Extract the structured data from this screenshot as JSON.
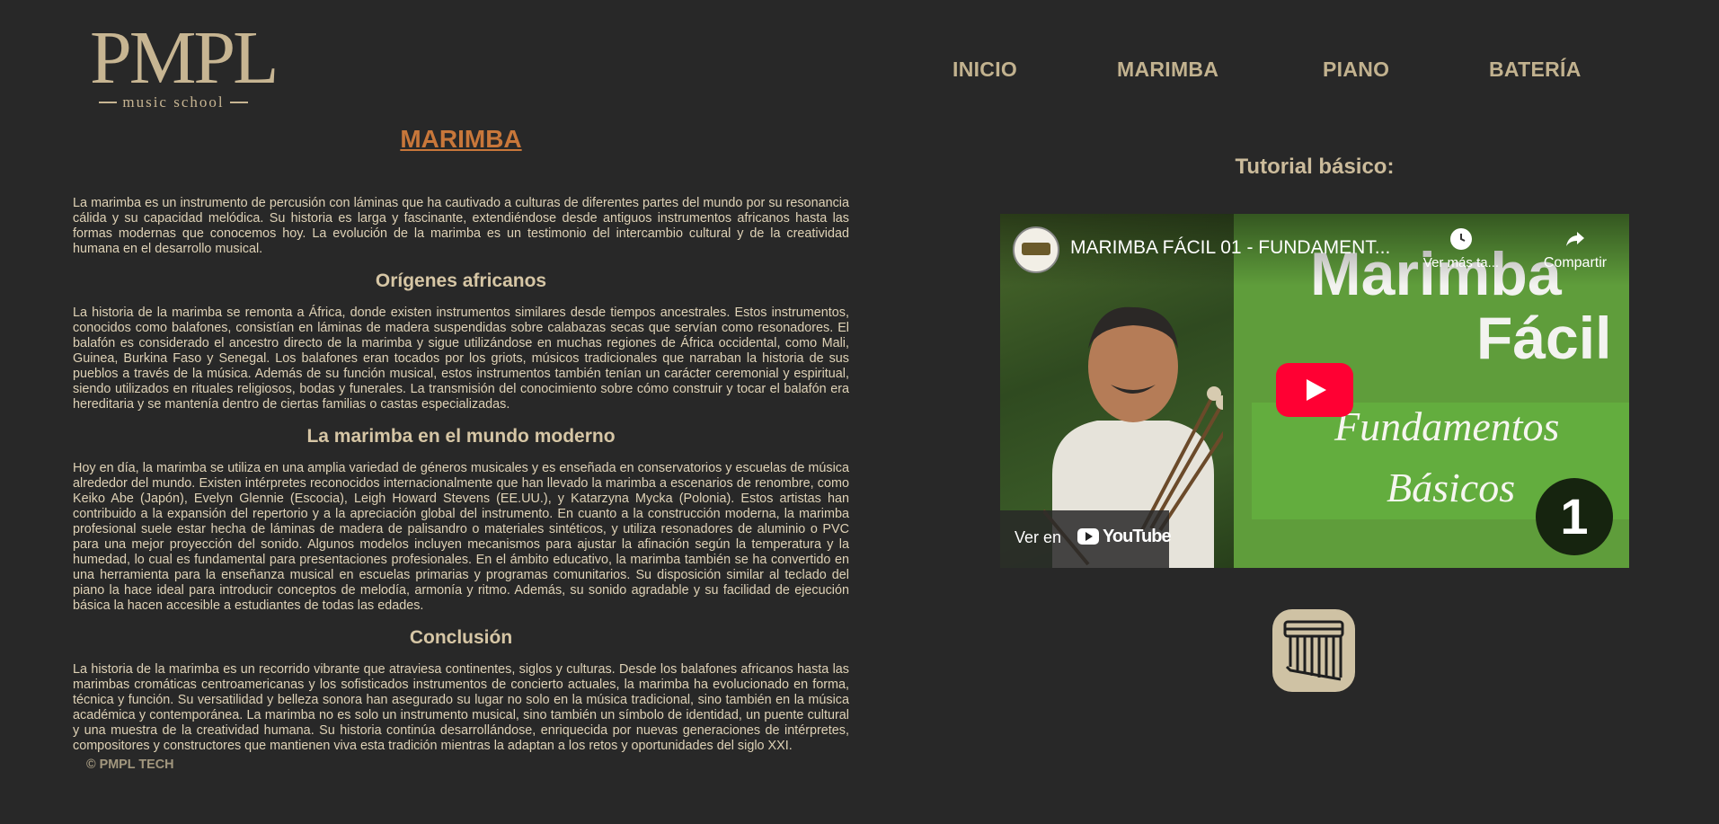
{
  "logo": {
    "mark": "PMPL",
    "sub": "music school"
  },
  "nav": {
    "items": [
      "INICIO",
      "MARIMBA",
      "PIANO",
      "BATERÍA"
    ]
  },
  "article": {
    "title": "MARIMBA",
    "intro": "La marimba es un instrumento de percusión con láminas que ha cautivado a culturas de diferentes partes del mundo por su resonancia cálida y su capacidad melódica. Su historia es larga y fascinante, extendiéndose desde antiguos instrumentos africanos hasta las formas modernas que conocemos hoy. La evolución de la marimba es un testimonio del intercambio cultural y de la creatividad humana en el desarrollo musical.",
    "sections": [
      {
        "heading": "Orígenes africanos",
        "text": "La historia de la marimba se remonta a África, donde existen instrumentos similares desde tiempos ancestrales. Estos instrumentos, conocidos como balafones, consistían en láminas de madera suspendidas sobre calabazas secas que servían como resonadores. El balafón es considerado el ancestro directo de la marimba y sigue utilizándose en muchas regiones de África occidental, como Mali, Guinea, Burkina Faso y Senegal. Los balafones eran tocados por los griots, músicos tradicionales que narraban la historia de sus pueblos a través de la música. Además de su función musical, estos instrumentos también tenían un carácter ceremonial y espiritual, siendo utilizados en rituales religiosos, bodas y funerales. La transmisión del conocimiento sobre cómo construir y tocar el balafón era hereditaria y se mantenía dentro de ciertas familias o castas especializadas."
      },
      {
        "heading": "La marimba en el mundo moderno",
        "text": "Hoy en día, la marimba se utiliza en una amplia variedad de géneros musicales y es enseñada en conservatorios y escuelas de música alrededor del mundo. Existen intérpretes reconocidos internacionalmente que han llevado la marimba a escenarios de renombre, como Keiko Abe (Japón), Evelyn Glennie (Escocia), Leigh Howard Stevens (EE.UU.), y Katarzyna Mycka (Polonia). Estos artistas han contribuido a la expansión del repertorio y a la apreciación global del instrumento. En cuanto a la construcción moderna, la marimba profesional suele estar hecha de láminas de madera de palisandro o materiales sintéticos, y utiliza resonadores de aluminio o PVC para una mejor proyección del sonido. Algunos modelos incluyen mecanismos para ajustar la afinación según la temperatura y la humedad, lo cual es fundamental para presentaciones profesionales. En el ámbito educativo, la marimba también se ha convertido en una herramienta para la enseñanza musical en escuelas primarias y programas comunitarios. Su disposición similar al teclado del piano la hace ideal para introducir conceptos de melodía, armonía y ritmo. Además, su sonido agradable y su facilidad de ejecución básica la hacen accesible a estudiantes de todas las edades."
      },
      {
        "heading": "Conclusión",
        "text": "La historia de la marimba es un recorrido vibrante que atraviesa continentes, siglos y culturas. Desde los balafones africanos hasta las marimbas cromáticas centroamericanas y los sofisticados instrumentos de concierto actuales, la marimba ha evolucionado en forma, técnica y función. Su versatilidad y belleza sonora han asegurado su lugar no solo en la música tradicional, sino también en la música académica y contemporánea. La marimba no es solo un instrumento musical, sino también un símbolo de identidad, un puente cultural y una muestra de la creatividad humana. Su historia continúa desarrollándose, enriquecida por nuevas generaciones de intérpretes, compositores y constructores que mantienen viva esta tradición mientras la adaptan a los retos y oportunidades del siglo XXI."
      }
    ]
  },
  "footer": {
    "text": "© PMPL TECH"
  },
  "tutorial": {
    "title": "Tutorial básico:"
  },
  "video": {
    "title": "MARIMBA FÁCIL 01 - FUNDAMENT...",
    "watch_later": "Ver más ta...",
    "share": "Compartir",
    "watch_on": "Ver en",
    "youtube": "YouTube",
    "thumb_line1": "Marimba",
    "thumb_line2": "Fácil",
    "thumb_line3": "Fundamentos",
    "thumb_line4": "Básicos",
    "thumb_number": "1",
    "colors": {
      "play": "#ff0033",
      "green": "#63ad3e"
    }
  },
  "icons": {
    "instrument": "pan-flute-icon"
  }
}
